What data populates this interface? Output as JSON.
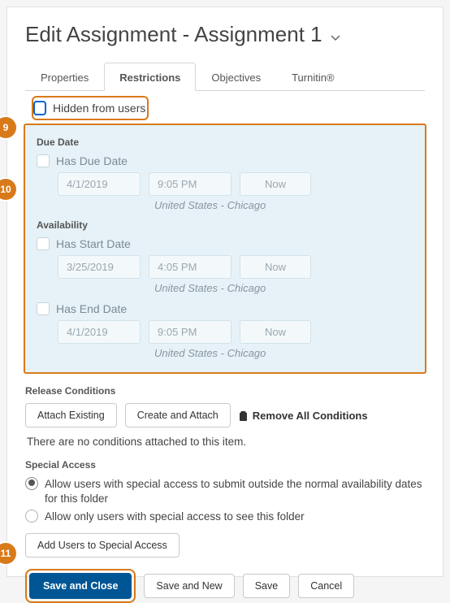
{
  "title": "Edit Assignment - Assignment 1",
  "tabs": [
    "Properties",
    "Restrictions",
    "Objectives",
    "Turnitin®"
  ],
  "activeTab": 1,
  "hiddenFromUsers": "Hidden from users",
  "sections": {
    "dueDate": {
      "header": "Due Date",
      "option": "Has Due Date",
      "date": "4/1/2019",
      "time": "9:05 PM",
      "now": "Now",
      "tz": "United States - Chicago"
    },
    "availability": {
      "header": "Availability",
      "start": {
        "option": "Has Start Date",
        "date": "3/25/2019",
        "time": "4:05 PM",
        "now": "Now",
        "tz": "United States - Chicago"
      },
      "end": {
        "option": "Has End Date",
        "date": "4/1/2019",
        "time": "9:05 PM",
        "now": "Now",
        "tz": "United States - Chicago"
      }
    }
  },
  "releaseConditions": {
    "header": "Release Conditions",
    "attachExisting": "Attach Existing",
    "createAttach": "Create and Attach",
    "removeAll": "Remove All Conditions",
    "empty": "There are no conditions attached to this item."
  },
  "specialAccess": {
    "header": "Special Access",
    "opt1": "Allow users with special access to submit outside the normal availability dates for this folder",
    "opt2": "Allow only users with special access to see this folder",
    "addBtn": "Add Users to Special Access"
  },
  "footer": {
    "saveClose": "Save and Close",
    "saveNew": "Save and New",
    "save": "Save",
    "cancel": "Cancel"
  },
  "callouts": {
    "c9": "9",
    "c10": "10",
    "c11": "11"
  }
}
